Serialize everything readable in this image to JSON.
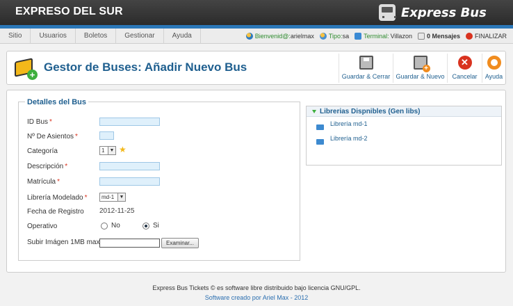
{
  "header": {
    "brand": "EXPRESO DEL SUR",
    "logo_text": "Express Bus"
  },
  "menu": {
    "items": [
      "Sitio",
      "Usuarios",
      "Boletos",
      "Gestionar",
      "Ayuda"
    ]
  },
  "status": {
    "welcome_label": "Bienvenid@:",
    "welcome_user": "arielmax",
    "type_label": "Tipo:",
    "type_value": "sa",
    "terminal_label": "Terminal:",
    "terminal_value": "Villazon",
    "messages": "0 Mensajes",
    "logout": "FINALIZAR"
  },
  "toolbar": {
    "title": "Gestor de Buses: Añadir Nuevo Bus",
    "save_close": "Guardar & Cerrar",
    "save_new": "Guardar & Nuevo",
    "cancel": "Cancelar",
    "help": "Ayuda"
  },
  "form": {
    "legend": "Detalles del Bus",
    "id_label": "ID Bus",
    "seats_label": "Nº De Asientos",
    "category_label": "Categoría",
    "category_value": "1",
    "description_label": "Descripción",
    "plate_label": "Matrícula",
    "model_label": "Librería Modelado",
    "model_value": "md-1",
    "date_label": "Fecha de Registro",
    "date_value": "2012-11-25",
    "operative_label": "Operativo",
    "operative_no": "No",
    "operative_yes": "Si",
    "upload_label": "Subir Imágen 1MB max",
    "browse": "Examinar...",
    "required_mark": "*"
  },
  "libraries": {
    "title": "Librerias Dispnibles (Gen libs)",
    "items": [
      "Librería md-1",
      "Librería md-2"
    ]
  },
  "footer": {
    "line1": "Express Bus Tickets © es software libre distribuido bajo licencia GNU/GPL.",
    "line2": "Software creado por Ariel Max - 2012"
  }
}
